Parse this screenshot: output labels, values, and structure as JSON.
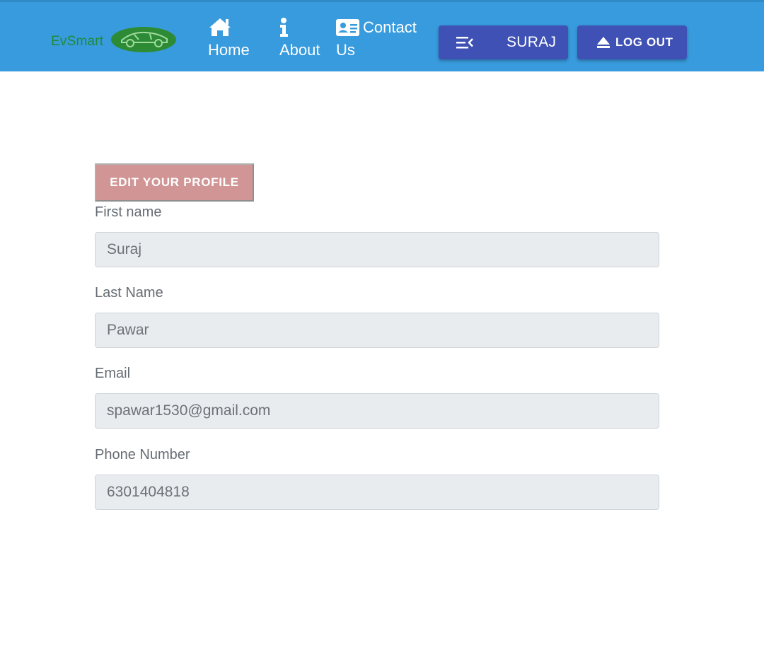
{
  "navbar": {
    "brand": "EvSmart",
    "links": [
      {
        "label": "Home",
        "icon": "home-icon"
      },
      {
        "label": "About",
        "icon": "info-icon"
      },
      {
        "label_line1": "Contact",
        "label_line2": "Us",
        "icon": "id-card-icon"
      }
    ],
    "user_button": {
      "label": "SURAJ",
      "icon": "menu-collapse-icon"
    },
    "logout_button": {
      "label": "LOG OUT",
      "icon": "eject-icon"
    }
  },
  "profile": {
    "edit_button": "EDIT YOUR PROFILE",
    "fields": [
      {
        "label": "First name",
        "value": "Suraj"
      },
      {
        "label": "Last Name",
        "value": "Pawar"
      },
      {
        "label": "Email",
        "value": "spawar1530@gmail.com"
      },
      {
        "label": "Phone Number",
        "value": "6301404818"
      }
    ]
  },
  "colors": {
    "navbar": "#389bdd",
    "button": "#3f51b5",
    "edit_button": "#d19595",
    "brand": "#1f8a3a",
    "input_bg": "#e9ecef"
  }
}
